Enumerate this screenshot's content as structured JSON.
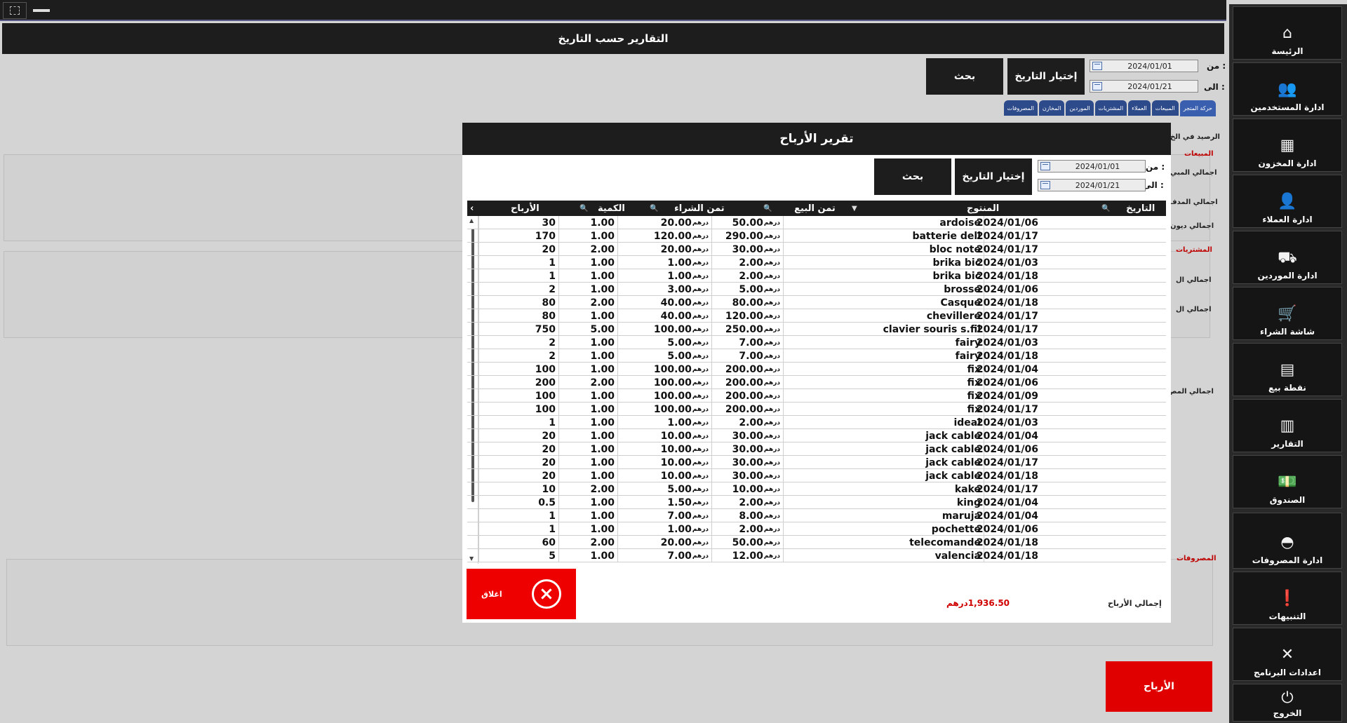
{
  "window": {
    "title": "التقارير حسب التاريخ"
  },
  "filter": {
    "from_label": "من :",
    "to_label": "الى :",
    "from_date": "2024/01/01",
    "to_date": "2024/01/21",
    "choose_date_label": "إختيار التاريخ",
    "search_label": "بحث"
  },
  "tabs": [
    {
      "label": "حركة المتجر",
      "active": true
    },
    {
      "label": "المبيعات"
    },
    {
      "label": "العملاء"
    },
    {
      "label": "المشتريات"
    },
    {
      "label": "الموردين"
    },
    {
      "label": "المخازن"
    },
    {
      "label": "المصروفات"
    }
  ],
  "background": {
    "balance_label": "الرصيد في الخ",
    "sales_section": "المبيعات",
    "sales_total": "اجمالي المبي",
    "paid_total": "اجمالي المدف",
    "debts_total": "اجمالي ديون",
    "purchases_section": "المشتريات",
    "purchases_total": "اجمالي ال",
    "purchases_total2": "اجمالي ال",
    "expenses_total": "اجمالي المص",
    "expenses_section": "المصروفات",
    "profits_button": "الأرباح"
  },
  "sidebar": {
    "items": [
      {
        "label": "الرئيسة",
        "icon": "home-icon"
      },
      {
        "label": "ادارة المستخدمين",
        "icon": "users-icon"
      },
      {
        "label": "ادارة المخزون",
        "icon": "warehouse-icon"
      },
      {
        "label": "ادارة العملاء",
        "icon": "customer-icon"
      },
      {
        "label": "ادارة الموردين",
        "icon": "supplier-icon"
      },
      {
        "label": "شاشة الشراء",
        "icon": "cart-icon"
      },
      {
        "label": "نقطة بيع",
        "icon": "pos-icon"
      },
      {
        "label": "التقارير",
        "icon": "reports-icon"
      },
      {
        "label": "الصندوق",
        "icon": "cashbox-icon"
      },
      {
        "label": "ادارة المصروفات",
        "icon": "expenses-icon"
      },
      {
        "label": "التنبيهات",
        "icon": "alert-icon"
      },
      {
        "label": "اعدادات البرنامج",
        "icon": "settings-icon"
      },
      {
        "label": "الخروج",
        "icon": "power-icon"
      }
    ]
  },
  "modal": {
    "title": "تقرير الأرباح",
    "from_label": "من :",
    "to_label": "الى :",
    "from_date": "2024/01/01",
    "to_date": "2024/01/21",
    "choose_date_label": "إختيار التاريخ",
    "search_label": "بحث",
    "columns": {
      "date": "التاريخ",
      "product": "المنتوج",
      "sell_price": "تمن البيع",
      "buy_price": "تمن الشراء",
      "quantity": "الكمية",
      "profit": "الأرباح"
    },
    "currency": "درهم",
    "rows": [
      {
        "date": "2024/01/06",
        "product": "ardoise",
        "sell": "50.00",
        "buy": "20.00",
        "qty": "1.00",
        "profit": "30"
      },
      {
        "date": "2024/01/17",
        "product": "batterie dell",
        "sell": "290.00",
        "buy": "120.00",
        "qty": "1.00",
        "profit": "170"
      },
      {
        "date": "2024/01/17",
        "product": "bloc note",
        "sell": "30.00",
        "buy": "20.00",
        "qty": "2.00",
        "profit": "20"
      },
      {
        "date": "2024/01/03",
        "product": "brika bic",
        "sell": "2.00",
        "buy": "1.00",
        "qty": "1.00",
        "profit": "1"
      },
      {
        "date": "2024/01/18",
        "product": "brika bic",
        "sell": "2.00",
        "buy": "1.00",
        "qty": "1.00",
        "profit": "1"
      },
      {
        "date": "2024/01/06",
        "product": "brosse",
        "sell": "5.00",
        "buy": "3.00",
        "qty": "1.00",
        "profit": "2"
      },
      {
        "date": "2024/01/18",
        "product": "Casque",
        "sell": "80.00",
        "buy": "40.00",
        "qty": "2.00",
        "profit": "80"
      },
      {
        "date": "2024/01/17",
        "product": "chevillere",
        "sell": "120.00",
        "buy": "40.00",
        "qty": "1.00",
        "profit": "80"
      },
      {
        "date": "2024/01/17",
        "product": "clavier souris s.fil",
        "sell": "250.00",
        "buy": "100.00",
        "qty": "5.00",
        "profit": "750"
      },
      {
        "date": "2024/01/03",
        "product": "fairy",
        "sell": "7.00",
        "buy": "5.00",
        "qty": "1.00",
        "profit": "2"
      },
      {
        "date": "2024/01/18",
        "product": "fairy",
        "sell": "7.00",
        "buy": "5.00",
        "qty": "1.00",
        "profit": "2"
      },
      {
        "date": "2024/01/04",
        "product": "fix",
        "sell": "200.00",
        "buy": "100.00",
        "qty": "1.00",
        "profit": "100"
      },
      {
        "date": "2024/01/06",
        "product": "fix",
        "sell": "200.00",
        "buy": "100.00",
        "qty": "2.00",
        "profit": "200"
      },
      {
        "date": "2024/01/09",
        "product": "fix",
        "sell": "200.00",
        "buy": "100.00",
        "qty": "1.00",
        "profit": "100"
      },
      {
        "date": "2024/01/17",
        "product": "fix",
        "sell": "200.00",
        "buy": "100.00",
        "qty": "1.00",
        "profit": "100"
      },
      {
        "date": "2024/01/03",
        "product": "ideal",
        "sell": "2.00",
        "buy": "1.00",
        "qty": "1.00",
        "profit": "1"
      },
      {
        "date": "2024/01/04",
        "product": "jack cable",
        "sell": "30.00",
        "buy": "10.00",
        "qty": "1.00",
        "profit": "20"
      },
      {
        "date": "2024/01/06",
        "product": "jack cable",
        "sell": "30.00",
        "buy": "10.00",
        "qty": "1.00",
        "profit": "20"
      },
      {
        "date": "2024/01/17",
        "product": "jack cable",
        "sell": "30.00",
        "buy": "10.00",
        "qty": "1.00",
        "profit": "20"
      },
      {
        "date": "2024/01/18",
        "product": "jack cable",
        "sell": "30.00",
        "buy": "10.00",
        "qty": "1.00",
        "profit": "20"
      },
      {
        "date": "2024/01/17",
        "product": "kake",
        "sell": "10.00",
        "buy": "5.00",
        "qty": "2.00",
        "profit": "10"
      },
      {
        "date": "2024/01/04",
        "product": "king",
        "sell": "2.00",
        "buy": "1.50",
        "qty": "1.00",
        "profit": "0.5"
      },
      {
        "date": "2024/01/04",
        "product": "maruja",
        "sell": "8.00",
        "buy": "7.00",
        "qty": "1.00",
        "profit": "1"
      },
      {
        "date": "2024/01/06",
        "product": "pochette",
        "sell": "2.00",
        "buy": "1.00",
        "qty": "1.00",
        "profit": "1"
      },
      {
        "date": "2024/01/18",
        "product": "telecomande",
        "sell": "50.00",
        "buy": "20.00",
        "qty": "2.00",
        "profit": "60"
      },
      {
        "date": "2024/01/18",
        "product": "valencia",
        "sell": "12.00",
        "buy": "7.00",
        "qty": "1.00",
        "profit": "5"
      }
    ],
    "close_label": "اغلاق",
    "total_label": "إجمالي الأرباح",
    "total_value": "1,936.50درهم"
  },
  "colors": {
    "dark": "#1d1d1d",
    "accent_red": "#ee0000",
    "tab_blue": "#2d4a8a",
    "total_red": "#d00000"
  }
}
